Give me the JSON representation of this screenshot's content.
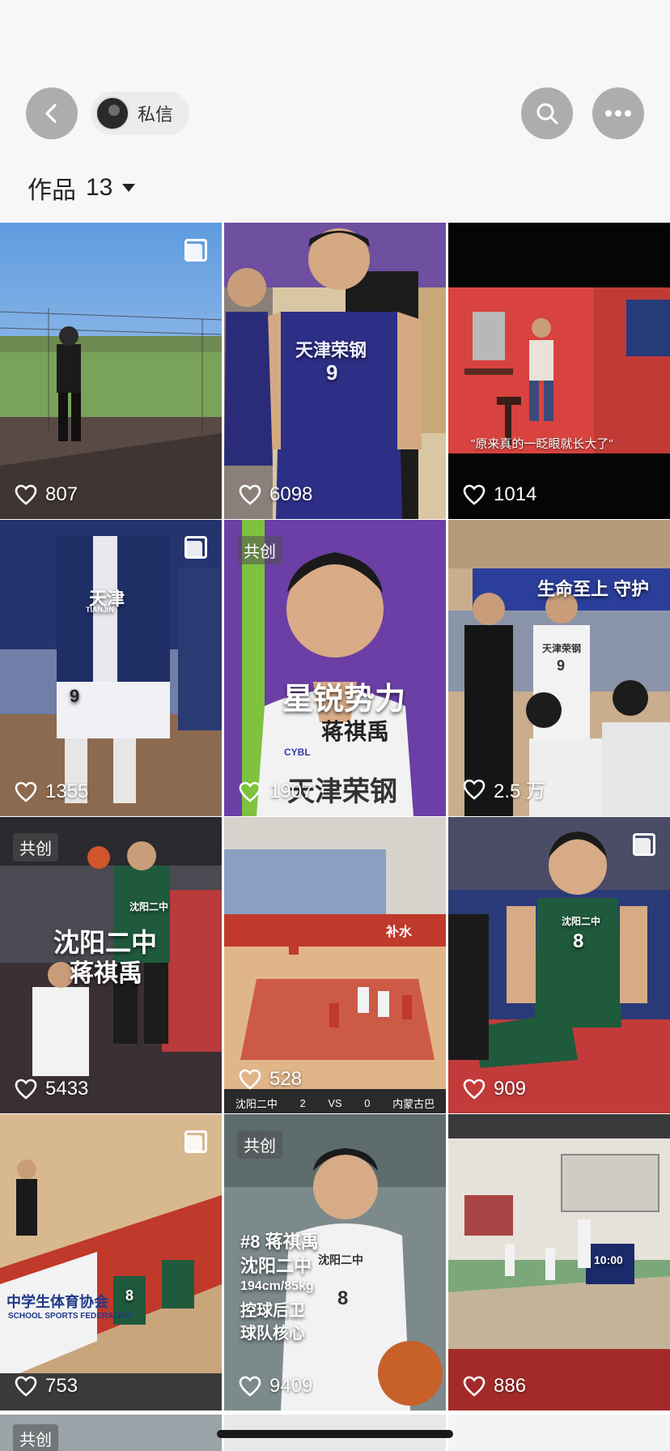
{
  "header": {
    "back_icon": "chevron-left-icon",
    "dm_label": "私信",
    "search_icon": "search-icon",
    "more_icon": "more-horizontal-icon"
  },
  "works": {
    "label": "作品",
    "count": "13",
    "caret_icon": "caret-down-icon"
  },
  "tiles": [
    {
      "likes": "807",
      "multi": true,
      "collab": ""
    },
    {
      "likes": "6098",
      "multi": false,
      "collab": "",
      "jersey": "天津荣钢",
      "jersey_number": "9"
    },
    {
      "likes": "1014",
      "multi": false,
      "collab": "",
      "caption": "\"原来真的一眨眼就长大了\""
    },
    {
      "likes": "1355",
      "multi": true,
      "collab": "",
      "jersey": "天津",
      "jersey_sub": "TIANJIN",
      "jersey_number": "9"
    },
    {
      "likes": "1907",
      "multi": false,
      "collab": "共创",
      "title": "星锐势力",
      "subtitle": "蒋祺禹",
      "jersey": "天津荣钢",
      "badge": "CYBL"
    },
    {
      "likes": "2.5 万",
      "multi": false,
      "collab": "",
      "banner": "生命至上 守护",
      "jersey": "天津荣钢",
      "jersey_number": "9"
    },
    {
      "likes": "5433",
      "multi": false,
      "collab": "共创",
      "title": "沈阳二中",
      "subtitle": "蒋祺禹",
      "jersey": "沈阳二中"
    },
    {
      "likes": "528",
      "multi": false,
      "collab": "",
      "scoreboard": [
        "沈阳二中",
        "2",
        "VS",
        "0",
        "内蒙古巴"
      ]
    },
    {
      "likes": "909",
      "multi": true,
      "collab": "",
      "jersey": "沈阳二中",
      "jersey_number": "8"
    },
    {
      "likes": "753",
      "multi": true,
      "collab": "",
      "banner": "中学生体育协会",
      "banner_sub": "SCHOOL SPORTS FEDERATION",
      "jersey_number": "8"
    },
    {
      "likes": "9409",
      "multi": false,
      "collab": "共创",
      "lines": [
        "#8 蒋祺禹",
        "沈阳二中",
        "194cm/85kg",
        "控球后卫",
        "球队核心"
      ],
      "jersey": "沈阳二中",
      "jersey_number": "8"
    },
    {
      "likes": "886",
      "multi": false,
      "collab": "",
      "score_display": "10:00"
    }
  ],
  "partial_row": {
    "collab": "共创"
  },
  "colors": {
    "header_bg": "#f7f7f7",
    "button_bg": "#adadad",
    "pill_bg": "#ececec"
  }
}
